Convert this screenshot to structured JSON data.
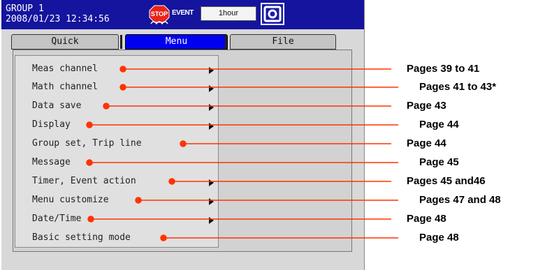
{
  "header": {
    "group_name": "GROUP 1",
    "datetime": "2008/01/23 12:34:56",
    "event_label": "EVENT",
    "period": "1hour",
    "stop_icon": "stop-icon",
    "record_icon": "record-icon"
  },
  "tabs": [
    {
      "label": "Quick",
      "selected": false
    },
    {
      "label": "Menu",
      "selected": true
    },
    {
      "label": "File",
      "selected": false
    }
  ],
  "menu": {
    "items": [
      {
        "label": "Meas channel",
        "has_submenu": true
      },
      {
        "label": "Math channel",
        "has_submenu": true
      },
      {
        "label": "Data save",
        "has_submenu": true
      },
      {
        "label": "Display",
        "has_submenu": true
      },
      {
        "label": "Group set, Trip line",
        "has_submenu": false
      },
      {
        "label": "Message",
        "has_submenu": false
      },
      {
        "label": "Timer, Event action",
        "has_submenu": true
      },
      {
        "label": "Menu customize",
        "has_submenu": true
      },
      {
        "label": "Date/Time",
        "has_submenu": true
      },
      {
        "label": "Basic setting mode",
        "has_submenu": false
      }
    ]
  },
  "callouts": [
    "Pages 39 to 41",
    "Pages 41 to 43*",
    "Page 43",
    "Page 44",
    "Page 44",
    "Page 45",
    "Pages 45 and46",
    "Pages 47 and 48",
    "Page 48",
    "Page 48"
  ],
  "colors": {
    "title_bar": "#14149e",
    "selected_tab": "#0000f0",
    "callout_line": "#ff3300"
  }
}
